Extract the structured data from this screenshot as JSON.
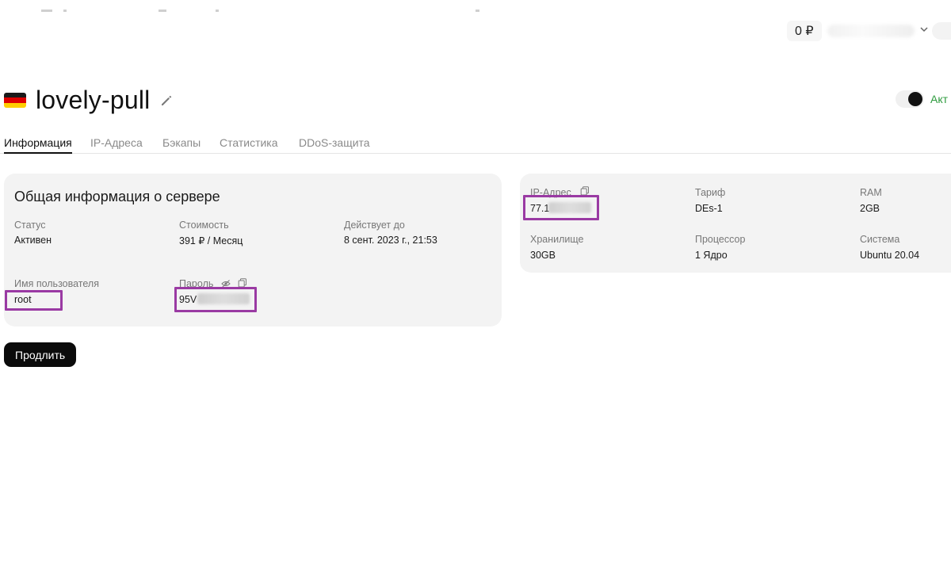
{
  "header": {
    "balance": "0 ₽"
  },
  "server": {
    "name": "lovely-pull",
    "status_toggle_label": "Акт"
  },
  "tabs": [
    {
      "label": "Информация",
      "active": true
    },
    {
      "label": "IP-Адреса",
      "active": false
    },
    {
      "label": "Бэкапы",
      "active": false
    },
    {
      "label": "Статистика",
      "active": false
    },
    {
      "label": "DDoS-защита",
      "active": false
    }
  ],
  "general": {
    "title": "Общая информация о сервере",
    "status_label": "Статус",
    "status_value": "Активен",
    "cost_label": "Стоимость",
    "cost_value": "391 ₽ / Месяц",
    "valid_label": "Действует до",
    "valid_value": "8 сент. 2023 г., 21:53",
    "username_label": "Имя пользователя",
    "username_value": "root",
    "password_label": "Пароль",
    "password_value": "95V"
  },
  "specs": {
    "ip_label": "IP-Адрес",
    "ip_value": "77.1",
    "tariff_label": "Тариф",
    "tariff_value": "DEs-1",
    "ram_label": "RAM",
    "ram_value": "2GB",
    "storage_label": "Хранилище",
    "storage_value": "30GB",
    "cpu_label": "Процессор",
    "cpu_value": "1 Ядро",
    "os_label": "Система",
    "os_value": "Ubuntu 20.04"
  },
  "actions": {
    "renew_label": "Продлить"
  },
  "colors": {
    "highlight": "#9a3aa3",
    "active_green": "#2e9b3e",
    "card_bg": "#f3f3f3"
  }
}
